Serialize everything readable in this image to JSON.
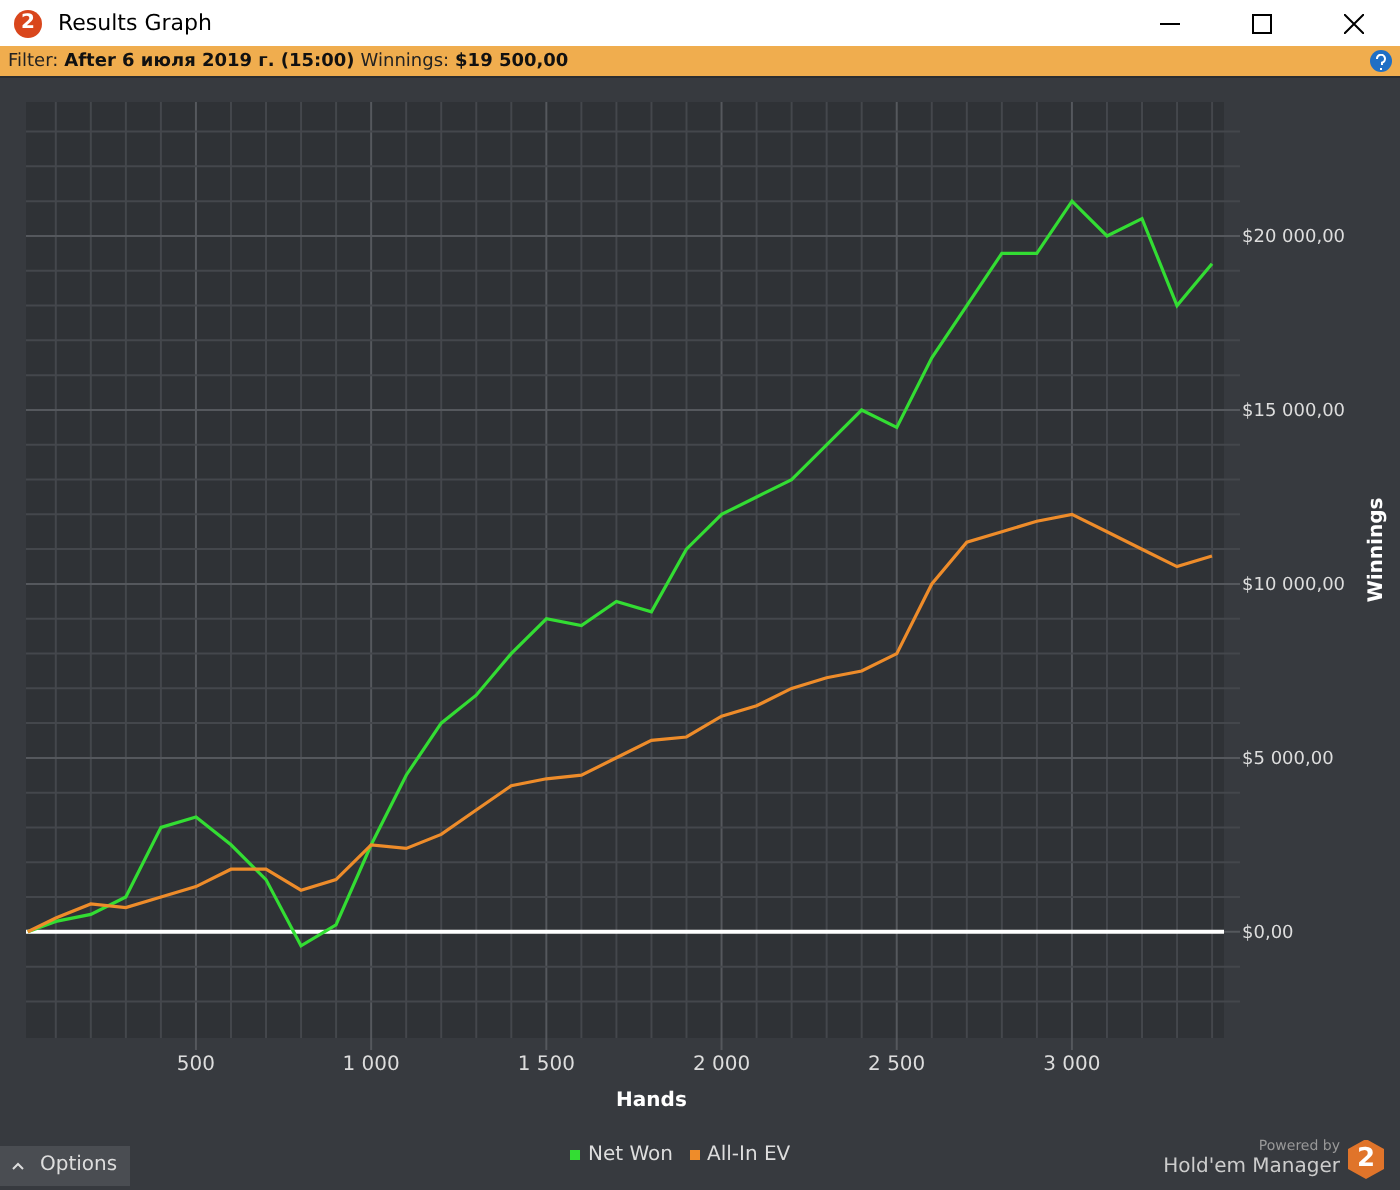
{
  "window": {
    "icon_text": "2",
    "title": "Results Graph"
  },
  "filter_bar": {
    "filter_label": "Filter:",
    "filter_value": "After 6 июля 2019 г. (15:00)",
    "winnings_label": "Winnings:",
    "winnings_value": "$19 500,00"
  },
  "chart": {
    "chart_data": {
      "type": "line",
      "grid": true,
      "xlabel": "Hands",
      "ylabel": "Winnings",
      "xlim": [
        15,
        3434
      ],
      "ylim": [
        -3050,
        23850
      ],
      "x": [
        20,
        100,
        200,
        300,
        400,
        500,
        600,
        700,
        800,
        900,
        1000,
        1100,
        1200,
        1300,
        1400,
        1500,
        1600,
        1700,
        1800,
        1900,
        2000,
        2100,
        2200,
        2300,
        2400,
        2500,
        2600,
        2700,
        2800,
        2900,
        3000,
        3100,
        3200,
        3300,
        3400
      ],
      "xticks": [
        {
          "value": 500,
          "label": "500"
        },
        {
          "value": 1000,
          "label": "1 000"
        },
        {
          "value": 1500,
          "label": "1 500"
        },
        {
          "value": 2000,
          "label": "2 000"
        },
        {
          "value": 2500,
          "label": "2 500"
        },
        {
          "value": 3000,
          "label": "3 000"
        }
      ],
      "yticks": [
        {
          "value": 0,
          "label": "$0,00"
        },
        {
          "value": 5000,
          "label": "$5 000,00"
        },
        {
          "value": 10000,
          "label": "$10 000,00"
        },
        {
          "value": 15000,
          "label": "$15 000,00"
        },
        {
          "value": 20000,
          "label": "$20 000,00"
        }
      ],
      "series": [
        {
          "name": "Net Won",
          "color": "#33dd33",
          "values": [
            0,
            300,
            500,
            1000,
            3000,
            3300,
            2500,
            1500,
            -400,
            200,
            2500,
            4500,
            6000,
            6800,
            8000,
            9000,
            8800,
            9500,
            9200,
            11000,
            12000,
            12500,
            13000,
            14000,
            15000,
            14500,
            16500,
            18000,
            19500,
            19500,
            21000,
            20000,
            20500,
            18000,
            19200
          ]
        },
        {
          "name": "All-In EV",
          "color": "#ee8c2a",
          "values": [
            0,
            400,
            800,
            700,
            1000,
            1300,
            1800,
            1800,
            1200,
            1500,
            2500,
            2400,
            2800,
            3500,
            4200,
            4400,
            4500,
            5000,
            5500,
            5600,
            6200,
            6500,
            7000,
            7300,
            7500,
            8000,
            10000,
            11200,
            11500,
            11800,
            12000,
            11500,
            11000,
            10500,
            10800
          ]
        }
      ]
    }
  },
  "footer": {
    "options_button": "Options",
    "powered_by": "Powered by",
    "product": "Hold'em Manager",
    "logo_text": "2"
  }
}
